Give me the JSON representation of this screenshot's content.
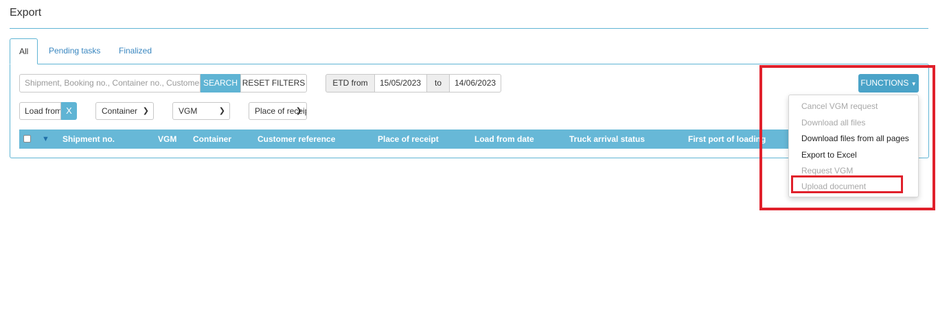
{
  "page": {
    "title": "Export"
  },
  "tabs": [
    {
      "label": "All",
      "active": true
    },
    {
      "label": "Pending tasks",
      "active": false
    },
    {
      "label": "Finalized",
      "active": false
    }
  ],
  "search": {
    "placeholder": "Shipment, Booking no., Container no., Customer reference",
    "search_label": "SEARCH",
    "reset_label": "RESET FILTERS"
  },
  "etd": {
    "from_label": "ETD from",
    "from_value": "15/05/2023",
    "to_label": "to",
    "to_value": "14/06/2023"
  },
  "filters": {
    "load_from_placeholder": "Load from",
    "clear_label": "X",
    "container_label": "Container",
    "vgm_label": "VGM",
    "place_label": "Place of receipt"
  },
  "table": {
    "columns": [
      "Shipment no.",
      "VGM",
      "Container",
      "Customer reference",
      "Place of receipt",
      "Load from date",
      "Truck arrival status",
      "First port of loading"
    ]
  },
  "functions": {
    "label": "FUNCTIONS",
    "items": [
      {
        "label": "Cancel VGM request",
        "enabled": false
      },
      {
        "label": "Download all files",
        "enabled": false
      },
      {
        "label": "Download files from all pages",
        "enabled": true
      },
      {
        "label": "Export to Excel",
        "enabled": true
      },
      {
        "label": "Request VGM",
        "enabled": false
      },
      {
        "label": "Upload document",
        "enabled": false
      }
    ]
  },
  "colors": {
    "accent": "#5fb4d4",
    "header": "#67b8d7",
    "highlight": "#e0202b"
  },
  "icons": {
    "dropdown": "chevron-down-icon",
    "checkbox": "checkbox"
  }
}
